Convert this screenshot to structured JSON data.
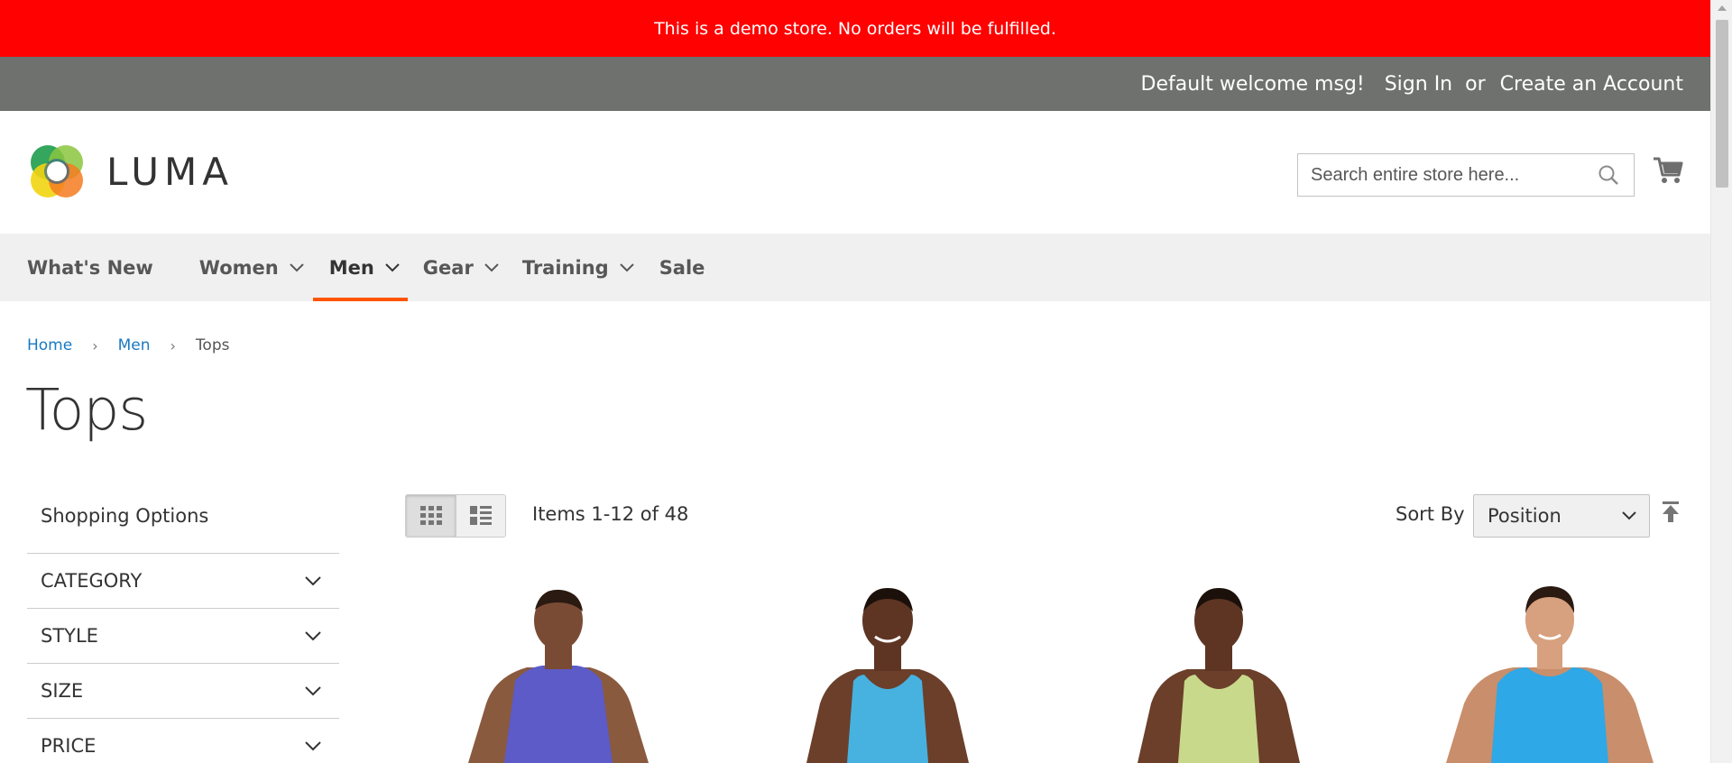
{
  "demo_notice": "This is a demo store. No orders will be fulfilled.",
  "header_links": {
    "welcome": "Default welcome msg!",
    "sign_in": "Sign In",
    "or": "or",
    "create_account": "Create an Account"
  },
  "logo": {
    "text": "LUMA"
  },
  "search": {
    "placeholder": "Search entire store here..."
  },
  "nav": {
    "items": [
      {
        "label": "What's New",
        "has_dropdown": false
      },
      {
        "label": "Women",
        "has_dropdown": true
      },
      {
        "label": "Men",
        "has_dropdown": true,
        "active": true
      },
      {
        "label": "Gear",
        "has_dropdown": true
      },
      {
        "label": "Training",
        "has_dropdown": true
      },
      {
        "label": "Sale",
        "has_dropdown": false
      }
    ]
  },
  "breadcrumb": {
    "items": [
      "Home",
      "Men"
    ],
    "current": "Tops"
  },
  "page_title": "Tops",
  "sidebar": {
    "title": "Shopping Options",
    "filters": [
      "CATEGORY",
      "STYLE",
      "SIZE",
      "PRICE"
    ]
  },
  "toolbar": {
    "amount": "Items 1-12 of 48",
    "sort_label": "Sort By",
    "sort_value": "Position"
  },
  "products": [
    {
      "image": "man-purple-sleeveless-shirt",
      "shirt_color": "#5c5bc7"
    },
    {
      "image": "man-blue-tank-top",
      "shirt_color": "#47b2e0"
    },
    {
      "image": "man-yellow-green-tank-top",
      "shirt_color": "#c9d98c"
    },
    {
      "image": "man-light-blue-sleeveless-shirt",
      "shirt_color": "#2ea8e6"
    }
  ],
  "colors": {
    "demo_bar": "#ff0101",
    "welcome_bar": "#6e716e",
    "nav_bg": "#f0f0f0",
    "nav_active": "#ff5501",
    "link": "#1979c3"
  }
}
